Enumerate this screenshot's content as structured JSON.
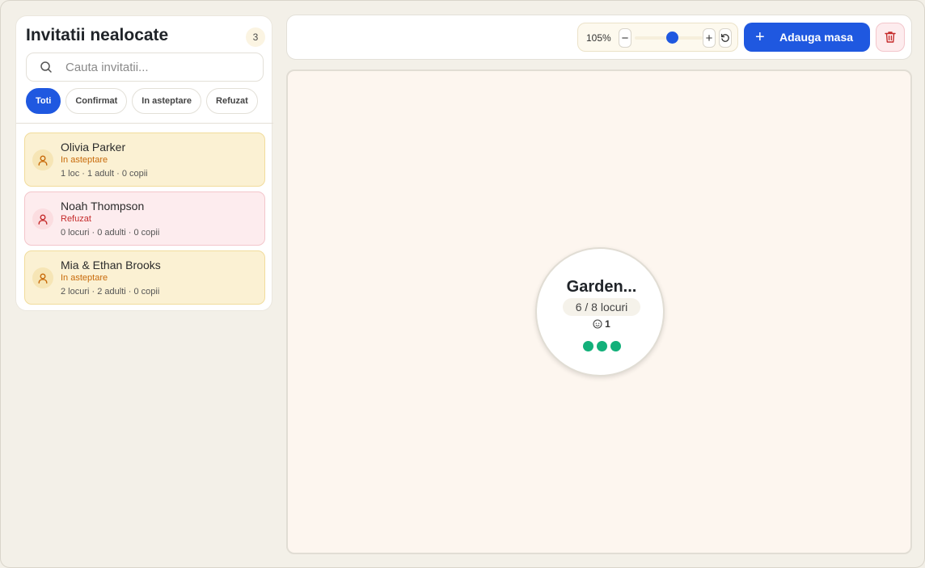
{
  "sidebar": {
    "title": "Invitatii nealocate",
    "count": "3",
    "search": {
      "placeholder": "Cauta invitatii..."
    },
    "filters": [
      "Toti",
      "Confirmat",
      "In asteptare",
      "Refuzat"
    ],
    "active_filter": "Toti",
    "invitations": [
      {
        "name": "Olivia Parker",
        "status": "In asteptare",
        "meta": "1 loc · 1 adult · 0 copii",
        "state": "pending"
      },
      {
        "name": "Noah Thompson",
        "status": "Refuzat",
        "meta": "0 locuri · 0 adulti · 0 copii",
        "state": "refused"
      },
      {
        "name": "Mia & Ethan Brooks",
        "status": "In asteptare",
        "meta": "2 locuri · 2 adulti · 0 copii",
        "state": "pending"
      }
    ]
  },
  "toolbar": {
    "zoom": "105%",
    "zoom_slider_fraction": 0.55,
    "zoom_out_icon": "minus-icon",
    "zoom_in_icon": "plus-icon",
    "reset_icon": "reset-icon",
    "add_table_label": "Adauga masa",
    "delete_icon": "trash-icon"
  },
  "canvas": {
    "table": {
      "name": "Garden...",
      "seats": "6 / 8 locuri",
      "kids": "1",
      "kids_icon": "child-icon",
      "guest_dots": 3,
      "dot_color": "#13b07a"
    }
  },
  "colors": {
    "accent": "#1f58e0",
    "pending_bg": "#fbf1d3",
    "refused_bg": "#fdecee",
    "canvas_bg": "#fdf6ef"
  }
}
